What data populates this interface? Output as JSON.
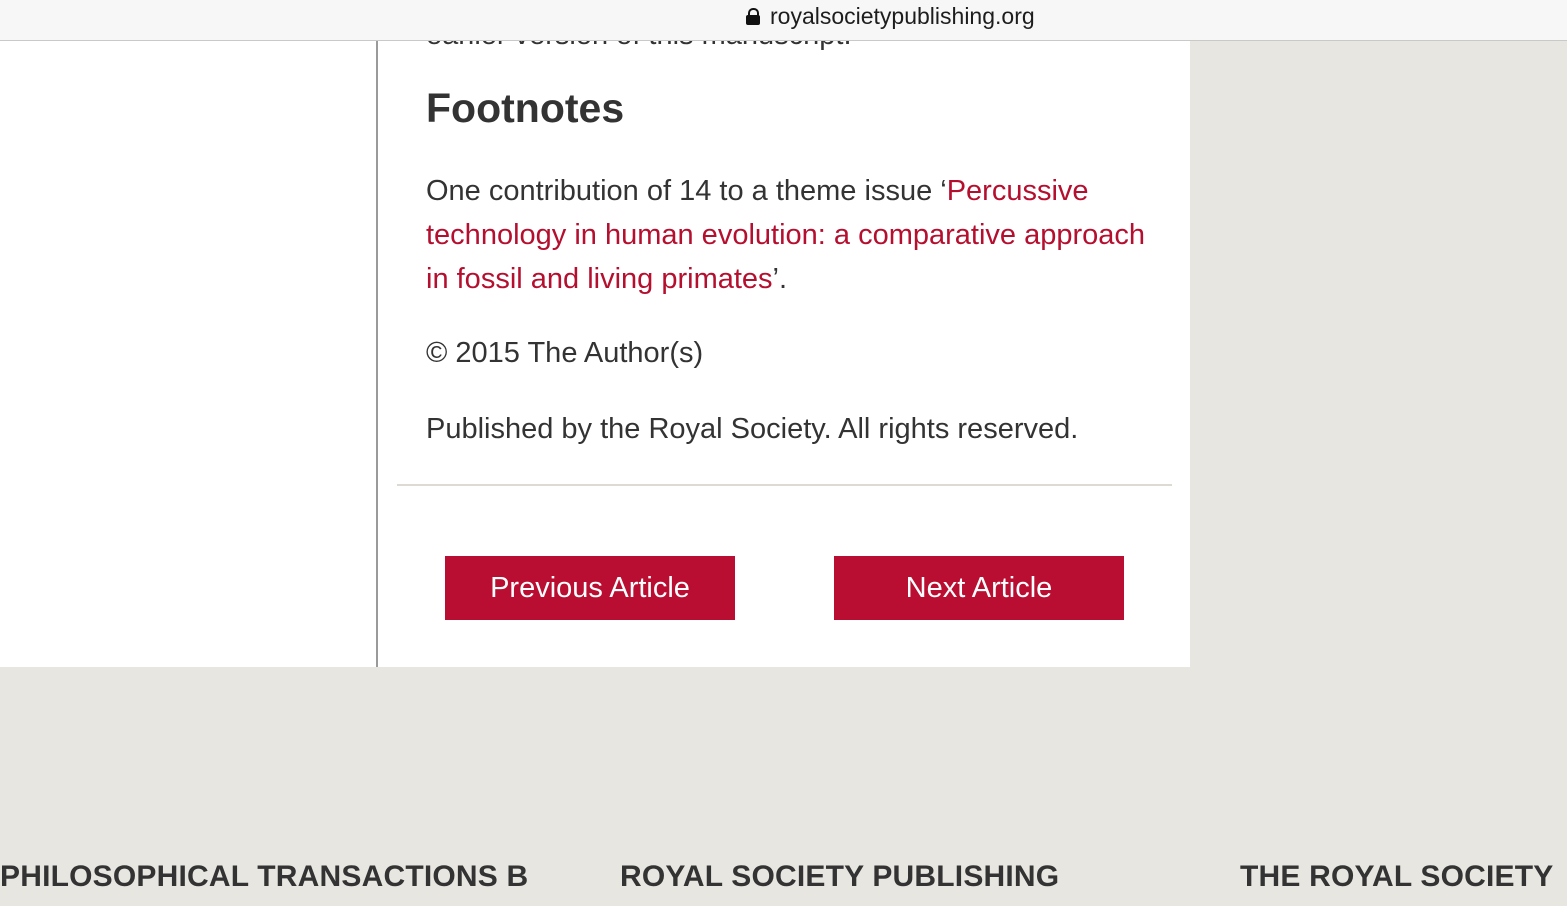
{
  "browser": {
    "url": "royalsocietypublishing.org",
    "lock_icon": "lock-icon"
  },
  "article": {
    "cut_off_text": "earlier version of this manuscript.",
    "footnotes_heading": "Footnotes",
    "footnote": {
      "prefix": "One contribution of 14 to a theme issue ‘",
      "link_text": "Percussive technology in human evolution: a comparative approach in fossil and living primates",
      "suffix": "’."
    },
    "copyright": "© 2015 The Author(s)",
    "published": "Published by the Royal Society. All rights reserved."
  },
  "navigation": {
    "previous_label": "Previous Article",
    "next_label": "Next Article"
  },
  "footer": {
    "links": [
      "PHILOSOPHICAL TRANSACTIONS B",
      "ROYAL SOCIETY PUBLISHING",
      "THE ROYAL SOCIETY"
    ]
  },
  "colors": {
    "accent": "#b90e31",
    "link": "#b50f2f",
    "text": "#333333",
    "page_background": "#e8e6e0"
  }
}
